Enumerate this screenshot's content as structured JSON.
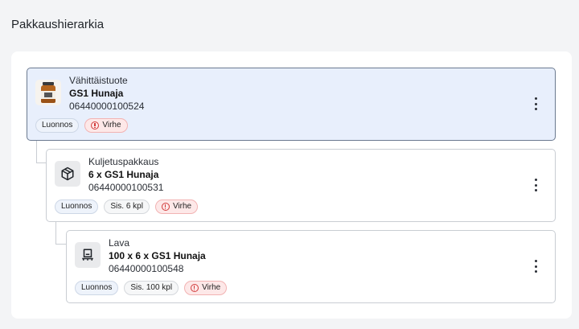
{
  "page": {
    "title": "Pakkaushierarkia"
  },
  "hierarchy": [
    {
      "type_label": "Vähittäistuote",
      "name": "GS1 Hunaja",
      "gtin": "06440000100524",
      "icon": "honey-jar-image",
      "selected": true,
      "badges": {
        "status": "Luonnos",
        "content": "",
        "error": "Virhe"
      }
    },
    {
      "type_label": "Kuljetuspakkaus",
      "name": "6 x GS1 Hunaja",
      "gtin": "06440000100531",
      "icon": "box-icon",
      "selected": false,
      "badges": {
        "status": "Luonnos",
        "content": "Sis. 6 kpl",
        "error": "Virhe"
      }
    },
    {
      "type_label": "Lava",
      "name": "100 x 6 x GS1 Hunaja",
      "gtin": "06440000100548",
      "icon": "pallet-icon",
      "selected": false,
      "badges": {
        "status": "Luonnos",
        "content": "Sis. 100 kpl",
        "error": "Virhe"
      }
    }
  ],
  "colors": {
    "selected_bg": "#e8effc",
    "error_red": "#d23c3c",
    "draft_bg": "#eef3fb"
  }
}
